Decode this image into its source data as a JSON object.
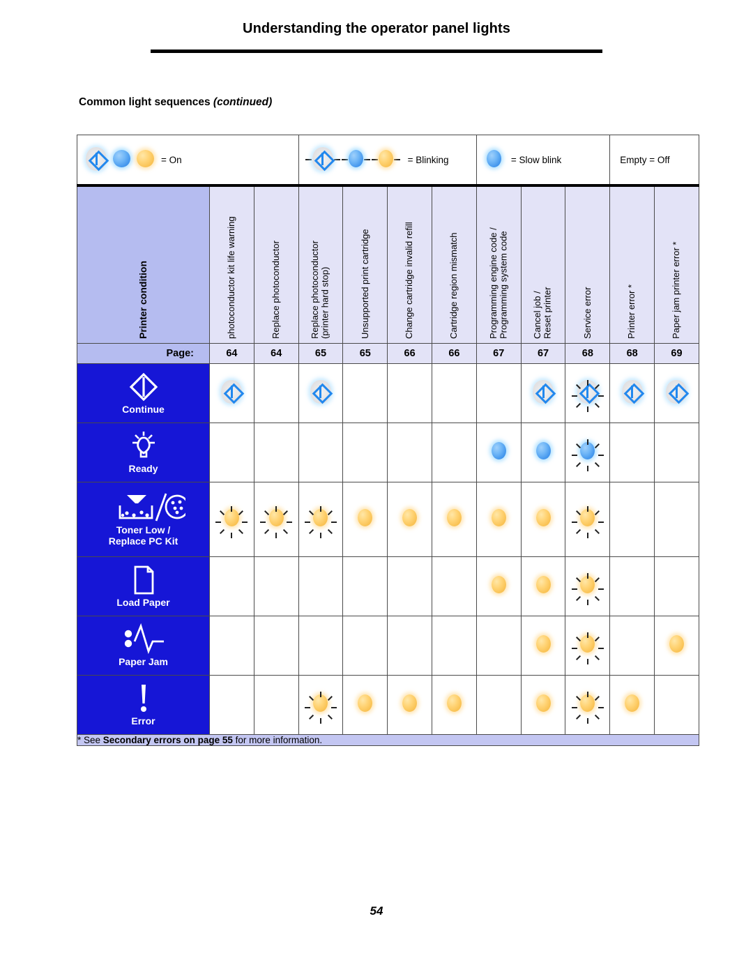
{
  "header": {
    "title": "Understanding the operator panel lights"
  },
  "section": {
    "title": "Common light sequences ",
    "continued": "(continued)"
  },
  "legend": [
    {
      "id": "on",
      "label": "= On",
      "icons": [
        "continue-on",
        "blue-on",
        "amber-on"
      ]
    },
    {
      "id": "blinking",
      "label": "= Blinking",
      "icons": [
        "continue-blink",
        "blue-blink",
        "amber-blink"
      ]
    },
    {
      "id": "slow-blink",
      "label": "= Slow blink",
      "icons": [
        "blue-blink"
      ]
    },
    {
      "id": "off",
      "label": "Empty = Off",
      "icons": []
    }
  ],
  "table": {
    "condition_header": "Printer condition",
    "page_label": "Page:",
    "columns": [
      {
        "label": "photoconductor kit life warning",
        "page": "64"
      },
      {
        "label": "Replace photoconductor",
        "page": "64"
      },
      {
        "label": "Replace photoconductor\n(printer hard stop)",
        "page": "65"
      },
      {
        "label": "Unsupported print cartridge",
        "page": "65"
      },
      {
        "label": "Change cartridge invalid refill",
        "page": "66"
      },
      {
        "label": "Cartridge region mismatch",
        "page": "66"
      },
      {
        "label": "Programming engine code /\nProgramming system code",
        "page": "67"
      },
      {
        "label": "Cancel job /\nReset printer",
        "page": "67"
      },
      {
        "label": "Service error",
        "page": "68"
      },
      {
        "label": "Printer error *",
        "page": "68"
      },
      {
        "label": "Paper jam printer error *",
        "page": "69"
      }
    ],
    "rows": [
      {
        "name": "continue",
        "label": "Continue",
        "icon": "continue-diamond-icon",
        "states": [
          "continue-on",
          "",
          "continue-on",
          "",
          "",
          "",
          "",
          "continue-on",
          "continue-blink",
          "continue-on",
          "continue-on"
        ]
      },
      {
        "name": "ready",
        "label": "Ready",
        "icon": "ready-bulb-icon",
        "states": [
          "",
          "",
          "",
          "",
          "",
          "",
          "blue-on",
          "blue-on",
          "blue-blink",
          "",
          ""
        ]
      },
      {
        "name": "toner-low",
        "label": "Toner Low /\nReplace PC Kit",
        "icon": "toner-cartridge-icon",
        "states": [
          "amber-blink",
          "amber-blink",
          "amber-blink",
          "amber-on",
          "amber-on",
          "amber-on",
          "amber-on",
          "amber-on",
          "amber-blink",
          "",
          ""
        ]
      },
      {
        "name": "load-paper",
        "label": "Load Paper",
        "icon": "paper-sheet-icon",
        "states": [
          "",
          "",
          "",
          "",
          "",
          "",
          "amber-on",
          "amber-on",
          "amber-blink",
          "",
          ""
        ]
      },
      {
        "name": "paper-jam",
        "label": "Paper Jam",
        "icon": "paper-jam-icon",
        "states": [
          "",
          "",
          "",
          "",
          "",
          "",
          "",
          "amber-on",
          "amber-blink",
          "",
          "amber-on"
        ]
      },
      {
        "name": "error",
        "label": "Error",
        "icon": "error-exclamation-icon",
        "states": [
          "",
          "",
          "amber-blink",
          "amber-on",
          "amber-on",
          "amber-on",
          "",
          "amber-on",
          "amber-blink",
          "amber-on",
          ""
        ]
      }
    ],
    "footnote": {
      "prefix": "* See ",
      "bold": "Secondary errors on page 55",
      "suffix": " for more information."
    }
  },
  "folio": "54",
  "colors": {
    "condition_blue": "#1616d6",
    "header_lavender": "#b5bcf0",
    "cell_lavender": "#e3e3f7",
    "footnote_lavender": "#c3c6f2",
    "indicator_blue": "#3f93ec",
    "indicator_amber": "#f8bf4e"
  }
}
